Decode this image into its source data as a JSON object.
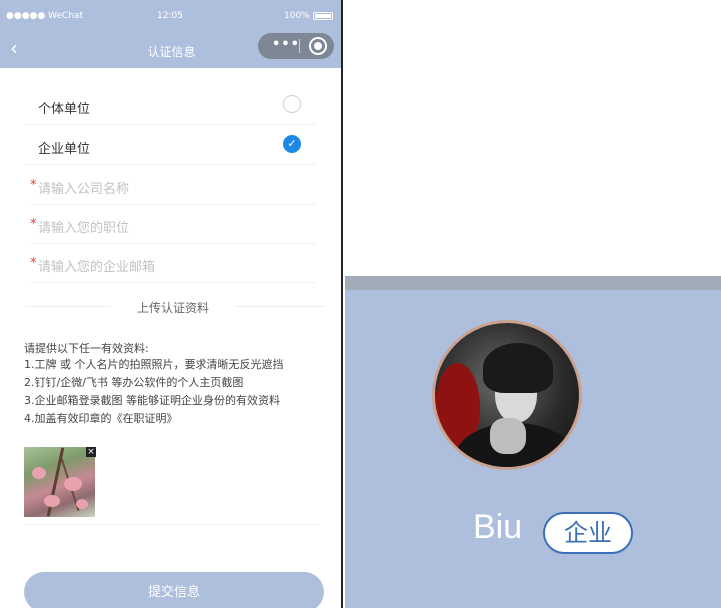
{
  "status_bar": {
    "carrier": "●●●●● WeChat",
    "time": "12:05",
    "battery": "100%"
  },
  "nav": {
    "back": "‹",
    "title": "认证信息",
    "more": "•••"
  },
  "options": [
    {
      "label": "个体单位",
      "selected": false
    },
    {
      "label": "企业单位",
      "selected": true
    }
  ],
  "fields": [
    {
      "required_mark": "*",
      "placeholder": "请输入公司名称"
    },
    {
      "required_mark": "*",
      "placeholder": "请输入您的职位"
    },
    {
      "required_mark": "*",
      "placeholder": "请输入您的企业邮箱"
    }
  ],
  "upload": {
    "title": "上传认证资料",
    "requirements": [
      "请提供以下任一有效资料:",
      "1.工牌 或 个人名片的拍照照片，要求清晰无反光遮挡",
      "2.钉钉/企微/飞书 等办公软件的个人主页截图",
      "3.企业邮箱登录截图 等能够证明企业身份的有效资料",
      "4.加盖有效印章的《在职证明》"
    ],
    "remove": "×"
  },
  "submit_label": "提交信息",
  "profile": {
    "name": "Biu",
    "badge": "企业"
  },
  "colors": {
    "accent": "#aebfde",
    "check": "#1e88e5",
    "required": "#e53935",
    "badge_border": "#3d6fb8"
  }
}
